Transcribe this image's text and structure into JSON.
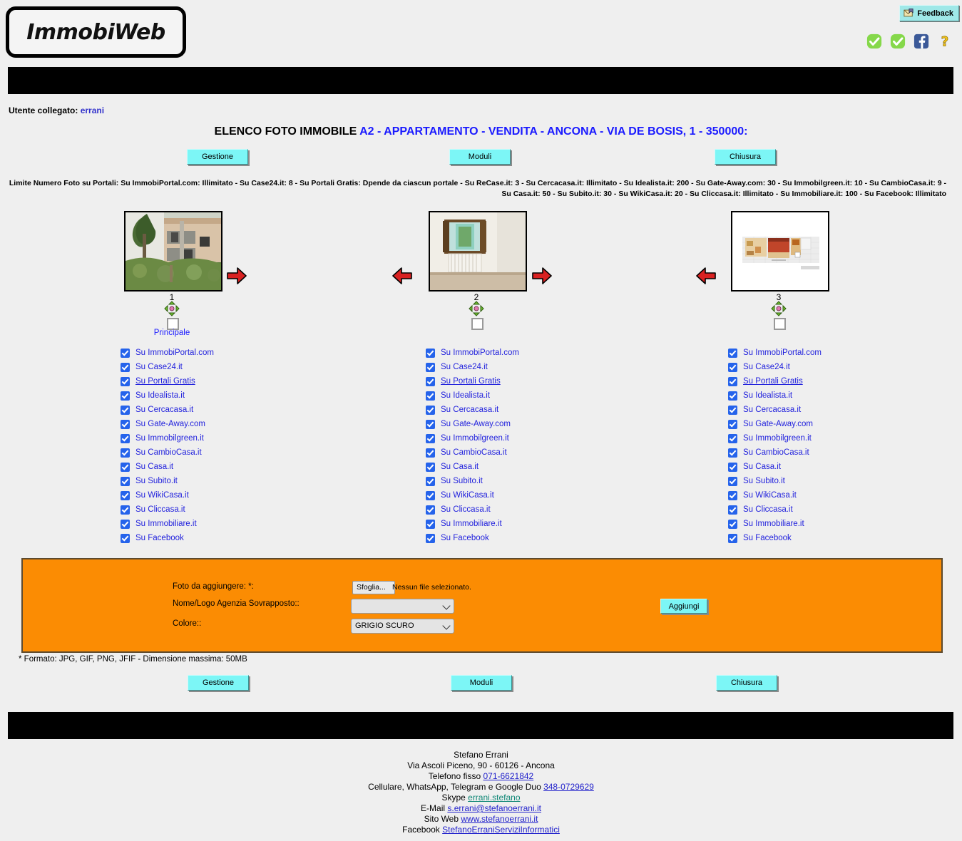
{
  "header": {
    "logo_text": "ImmobiWeb",
    "feedback_label": "Feedback",
    "icons": [
      "green-check-icon",
      "green-check-icon",
      "facebook-icon",
      "help-question-icon"
    ]
  },
  "user": {
    "prefix": "Utente collegato:",
    "name": "errani"
  },
  "title": {
    "prefix": "ELENCO FOTO IMMOBILE ",
    "highlight": "A2 - APPARTAMENTO - VENDITA - ANCONA - VIA DE BOSIS, 1 - 350000:"
  },
  "nav": {
    "gestione": "Gestione",
    "moduli": "Moduli",
    "chiusura": "Chiusura"
  },
  "limits": {
    "line1": "Limite Numero Foto su Portali:  Su ImmobiPortal.com: Illimitato - Su Case24.it: 8 - Su Portali Gratis: Dpende da ciascun portale - Su ReCase.it: 3 - Su Cercacasa.it: Illimitato - Su Idealista.it: 200 - Su Gate-Away.com: 30 - Su Immobilgreen.it: 10 - Su CambioCasa.it: 9 - Su Casa.it: 50 - Su",
    "line2": "Subito.it: 30 - Su WikiCasa.it: 20 - Su Cliccasa.it: Illimitato - Su Immobiliare.it: 100 - Su Facebook: Illimitato"
  },
  "portals": [
    {
      "label": "Su ImmobiPortal.com",
      "link": false
    },
    {
      "label": "Su Case24.it",
      "link": false
    },
    {
      "label": "Su Portali Gratis",
      "link": true
    },
    {
      "label": "Su Idealista.it",
      "link": false
    },
    {
      "label": "Su Cercacasa.it",
      "link": false
    },
    {
      "label": "Su Gate-Away.com",
      "link": false
    },
    {
      "label": "Su Immobilgreen.it",
      "link": false
    },
    {
      "label": "Su CambioCasa.it",
      "link": false
    },
    {
      "label": "Su Casa.it",
      "link": false
    },
    {
      "label": "Su Subito.it",
      "link": false
    },
    {
      "label": "Su WikiCasa.it",
      "link": false
    },
    {
      "label": "Su Cliccasa.it",
      "link": false
    },
    {
      "label": "Su Immobiliare.it",
      "link": false
    },
    {
      "label": "Su Facebook",
      "link": false
    }
  ],
  "photos": [
    {
      "number": "1",
      "alt": "building-exterior-photo",
      "principale_label": "Principale",
      "has_left_arrow": false,
      "has_right_arrow": true,
      "checked": false
    },
    {
      "number": "2",
      "alt": "room-with-window-photo",
      "principale_label": "",
      "has_left_arrow": true,
      "has_right_arrow": true,
      "checked": false
    },
    {
      "number": "3",
      "alt": "floorplan-photo",
      "principale_label": "",
      "has_left_arrow": true,
      "has_right_arrow": false,
      "checked": false
    }
  ],
  "upload_form": {
    "foto_label": "Foto da aggiungere: *:",
    "browse_button": "Sfoglia...",
    "file_status": "Nessun file selezionato.",
    "logo_label": "Nome/Logo Agenzia Sovrapposto::",
    "logo_value": "",
    "colore_label": "Colore::",
    "colore_value": "GRIGIO SCURO",
    "add_button": "Aggiungi"
  },
  "format_note": "* Formato: JPG, GIF, PNG, JFIF - Dimensione massima: 50MB",
  "footer": {
    "name": "Stefano Errani",
    "address": "Via Ascoli Piceno, 90 - 60126 - Ancona",
    "phone_prefix": "Telefono fisso ",
    "phone": "071-6621842",
    "mobile_prefix": "Cellulare, WhatsApp, Telegram e Google Duo ",
    "mobile": "348-0729629",
    "skype_prefix": "Skype ",
    "skype": "errani.stefano",
    "email_prefix": "E-Mail ",
    "email": "s.errani@stefanoerrani.it",
    "site_prefix": "Sito Web ",
    "site": "www.stefanoerrani.it",
    "facebook_prefix": "Facebook ",
    "facebook": "StefanoErraniServiziInformatici"
  },
  "colors": {
    "button": "#7cf6f6",
    "orange_panel": "#fb8c03",
    "link_blue": "#2222dd",
    "checkbox_blue": "#2563eb"
  }
}
